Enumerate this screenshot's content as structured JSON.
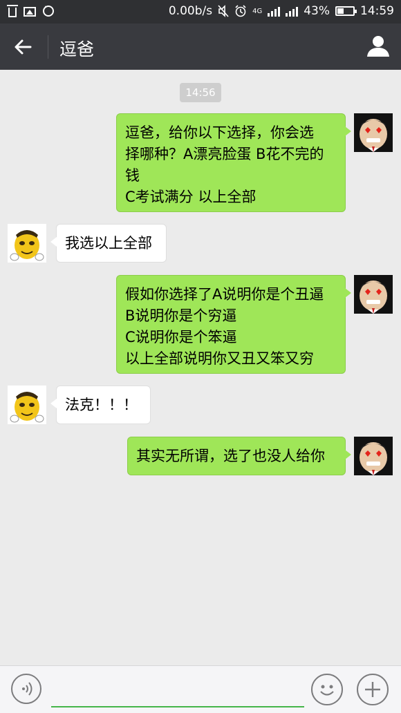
{
  "status_bar": {
    "speed": "0.00b/s",
    "network": "4G",
    "battery_percent": "43%",
    "battery_level": 0.43,
    "time": "14:59"
  },
  "header": {
    "title": "逗爸",
    "back_icon": "arrow-left-icon",
    "profile_icon": "person-icon"
  },
  "chat": {
    "timestamp": "14:56",
    "messages": [
      {
        "sender": "me",
        "avatar": "monkey-avatar",
        "lines": [
          "逗爸，给你以下选择，你会选",
          "择哪种？A漂亮脸蛋 B花不完的",
          "钱",
          "C考试满分 以上全部"
        ]
      },
      {
        "sender": "other",
        "avatar": "yellow-face-avatar",
        "lines": [
          "我选以上全部"
        ]
      },
      {
        "sender": "me",
        "avatar": "monkey-avatar",
        "lines": [
          "假如你选择了A说明你是个丑逼",
          "B说明你是个穷逼",
          "C说明你是个笨逼",
          "以上全部说明你又丑又笨又穷"
        ]
      },
      {
        "sender": "other",
        "avatar": "yellow-face-avatar",
        "lines": [
          "法克！！！"
        ]
      },
      {
        "sender": "me",
        "avatar": "monkey-avatar",
        "lines": [
          "其实无所谓，选了也没人给你"
        ]
      }
    ]
  },
  "input_bar": {
    "voice_icon": "voice-icon",
    "emoji_icon": "emoji-icon",
    "plus_icon": "plus-icon",
    "value": ""
  },
  "colors": {
    "status_bg": "#2f3033",
    "header_bg": "#393a3f",
    "chat_bg": "#ebebeb",
    "sent_bubble": "#9fe658",
    "recv_bubble": "#ffffff",
    "input_accent": "#44b549"
  }
}
